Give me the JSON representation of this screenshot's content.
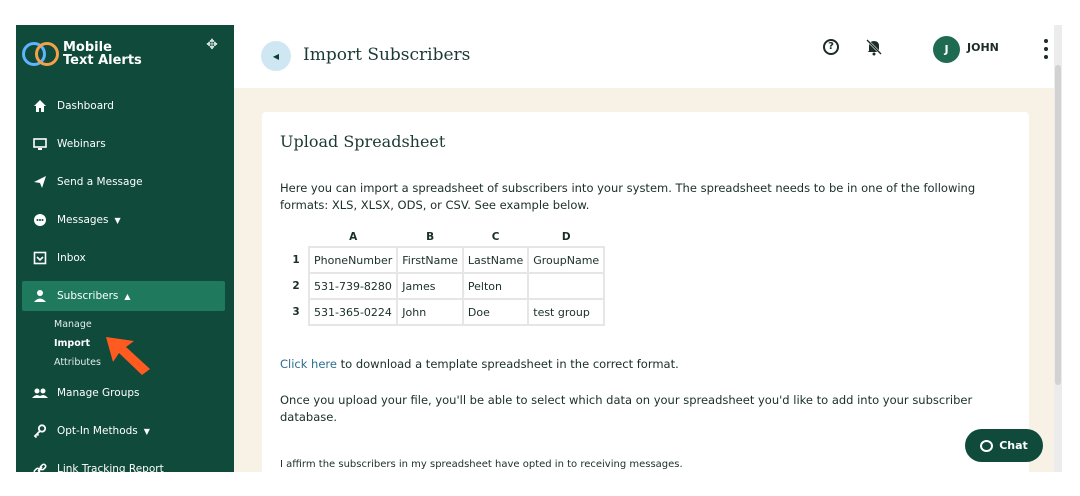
{
  "brand": {
    "name_line1": "Mobile",
    "name_line2": "Text Alerts"
  },
  "sidebar": {
    "items": [
      {
        "label": "Dashboard",
        "icon": "home-icon"
      },
      {
        "label": "Webinars",
        "icon": "monitor-icon"
      },
      {
        "label": "Send a Message",
        "icon": "send-icon"
      },
      {
        "label": "Messages",
        "icon": "chat-icon",
        "caret": "▼"
      },
      {
        "label": "Inbox",
        "icon": "inbox-icon"
      },
      {
        "label": "Subscribers",
        "icon": "user-icon",
        "caret": "▲"
      },
      {
        "label": "Manage Groups",
        "icon": "group-icon"
      },
      {
        "label": "Opt-In Methods",
        "icon": "key-icon",
        "caret": "▼"
      },
      {
        "label": "Link Tracking Report",
        "icon": "link-icon"
      }
    ],
    "subscribers_sub": [
      "Manage",
      "Import",
      "Attributes"
    ]
  },
  "header": {
    "title": "Import Subscribers",
    "avatar_letter": "J",
    "user_name": "JOHN"
  },
  "card": {
    "title": "Upload Spreadsheet",
    "intro": "Here you can import a spreadsheet of subscribers into your system. The spreadsheet needs to be in one of the following formats: XLS, XLSX, ODS, or CSV. See example below.",
    "sheet": {
      "columns": [
        "A",
        "B",
        "C",
        "D"
      ],
      "rows": [
        {
          "num": "1",
          "cells": [
            "PhoneNumber",
            "FirstName",
            "LastName",
            "GroupName"
          ]
        },
        {
          "num": "2",
          "cells": [
            "531-739-8280",
            "James",
            "Pelton",
            ""
          ]
        },
        {
          "num": "3",
          "cells": [
            "531-365-0224",
            "John",
            "Doe",
            "test group"
          ]
        }
      ]
    },
    "link_text": "Click here",
    "link_rest": " to download a template spreadsheet in the correct format.",
    "upload_text": "Once you upload your file, you'll be able to select which data on your spreadsheet you'd like to add into your subscriber database.",
    "affirm": "I affirm the subscribers in my spreadsheet have opted in to receiving messages."
  },
  "chat": {
    "label": "Chat"
  },
  "colors": {
    "sidebar": "#0f4a3a",
    "active": "#1f7a5d",
    "link": "#2b6e8f",
    "arrow": "#ff5a1f"
  }
}
